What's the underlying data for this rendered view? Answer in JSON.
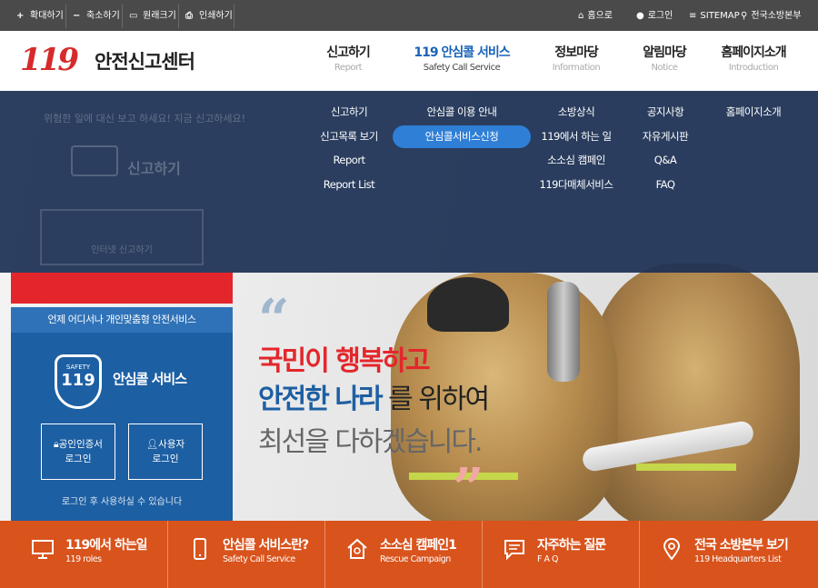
{
  "toolbar": {
    "zoom_in": "확대하기",
    "zoom_out": "축소하기",
    "original_size": "원래크기",
    "print": "인쇄하기",
    "home": "홈으로",
    "login": "로그인",
    "sitemap": "SITEMAP",
    "hq": "전국소방본부"
  },
  "logo": {
    "number": "119",
    "text": "안전신고센터"
  },
  "gnb": [
    {
      "ko": "신고하기",
      "en": "Report"
    },
    {
      "ko": "119 안심콜 서비스",
      "en": "Safety Call Service"
    },
    {
      "ko": "정보마당",
      "en": "Information"
    },
    {
      "ko": "알림마당",
      "en": "Notice"
    },
    {
      "ko": "홈페이지소개",
      "en": "Introduction"
    }
  ],
  "dropdown": {
    "report": [
      "신고하기",
      "신고목록 보기",
      "Report",
      "Report List"
    ],
    "safety_call": [
      "안심콜 이용 안내",
      "안심콜서비스신청"
    ],
    "info": [
      "소방상식",
      "119에서 하는 일",
      "소소심 캠페인",
      "119다매체서비스"
    ],
    "notice": [
      "공지사항",
      "자유게시판",
      "Q&A",
      "FAQ"
    ],
    "intro": [
      "홈페이지소개"
    ]
  },
  "ghost_panel": {
    "line1": "위험한 일에 대신 보고 하세요! 지금 신고하세요!",
    "title": "신고하기",
    "button": "인터넷 신고하기"
  },
  "service_panel": {
    "heading": "언제 어디서나 개인맞춤형 안전서비스",
    "shield_top": "SAFETY",
    "shield_num": "119",
    "title": "안심콜 서비스",
    "cert_login": "공인인증서\n로그인",
    "user_login": "사용자\n로그인",
    "note": "로그인 후 사용하실 수 있습니다"
  },
  "hero": {
    "line1": "국민이 행복하고",
    "line2_strong1": "안전한",
    "line2_strong2": "나라",
    "line2_rest": "를 위하여",
    "line3": "최선을 다하겠습니다."
  },
  "quick_menu": [
    {
      "title": "119에서 하는일",
      "sub": "119 roles",
      "icon": "monitor-icon"
    },
    {
      "title": "안심콜 서비스란?",
      "sub": "Safety Call Service",
      "icon": "phone-icon"
    },
    {
      "title": "소소심 캠페인1",
      "sub": "Rescue Campaign",
      "icon": "house-icon"
    },
    {
      "title": "자주하는 질문",
      "sub": "F A Q",
      "icon": "chat-icon"
    },
    {
      "title": "전국 소방본부 보기",
      "sub": "119 Headquarters List",
      "icon": "map-pin-icon"
    }
  ],
  "colors": {
    "red": "#e3262b",
    "blue": "#1d5fa3",
    "orange": "#d9531c",
    "nav_dark": "#1c3054"
  }
}
